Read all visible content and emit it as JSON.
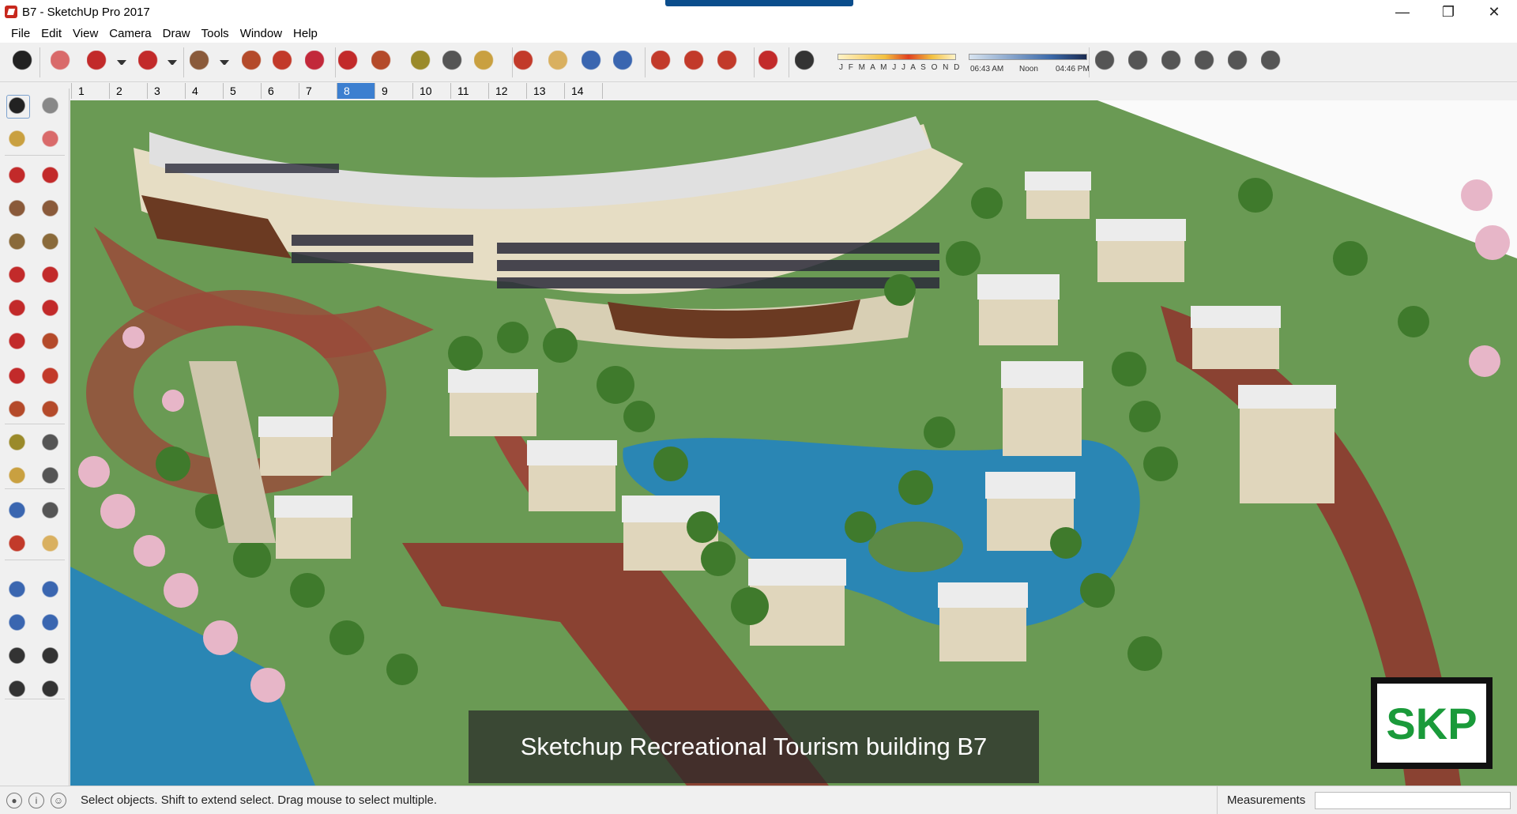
{
  "window": {
    "title": "B7 - SketchUp Pro 2017",
    "controls": {
      "minimize": "—",
      "maximize": "❐",
      "close": "✕"
    }
  },
  "menu": [
    "File",
    "Edit",
    "View",
    "Camera",
    "Draw",
    "Tools",
    "Window",
    "Help"
  ],
  "toolbar": {
    "icons": [
      "select-tool-icon",
      "eraser-icon",
      "pencil-line-icon",
      "dropdown-icon",
      "arc-icon",
      "dropdown-icon",
      "rectangle-icon",
      "dropdown-icon",
      "push-pull-icon",
      "follow-me-icon",
      "move-icon",
      "rotate-icon",
      "scale-icon",
      "tape-measure-icon",
      "text-icon",
      "paint-bucket-icon",
      "orbit-icon",
      "pan-icon",
      "zoom-icon",
      "zoom-extents-icon",
      "3d-warehouse-icon",
      "extension-warehouse-icon",
      "layout-send-icon",
      "ruby-icon",
      "shadow-toggle-icon",
      "iso-view-icon",
      "top-view-icon",
      "front-view-icon",
      "right-view-icon",
      "back-view-icon",
      "left-view-icon"
    ],
    "shadow": {
      "months": "J F M A M J J A S O N D",
      "time_start": "06:43 AM",
      "time_mid": "Noon",
      "time_end": "04:46 PM"
    }
  },
  "scenes": {
    "tabs": [
      "1",
      "2",
      "3",
      "4",
      "5",
      "6",
      "7",
      "8",
      "9",
      "10",
      "11",
      "12",
      "13",
      "14"
    ],
    "active_index": 7
  },
  "left_palette": {
    "icons": [
      "select-icon",
      "make-component-icon",
      "paint-bucket-icon",
      "eraser-icon",
      "line-icon",
      "freehand-icon",
      "rectangle-icon",
      "rotated-rectangle-icon",
      "circle-icon",
      "polygon-icon",
      "arc-icon",
      "two-point-arc-icon",
      "pie-icon",
      "three-point-arc-icon",
      "move-icon",
      "push-pull-icon",
      "rotate-icon",
      "follow-me-icon",
      "scale-icon",
      "offset-icon",
      "tape-measure-icon",
      "dimension-icon",
      "protractor-icon",
      "text-icon",
      "axes-icon",
      "3d-text-icon",
      "orbit-icon",
      "pan-icon",
      "zoom-icon",
      "zoom-window-icon",
      "zoom-extents-icon",
      "previous-view-icon",
      "position-camera-icon",
      "look-around-icon",
      "walk-icon",
      "section-plane-icon"
    ]
  },
  "viewport": {
    "caption": "Sketchup Recreational Tourism building B7",
    "badge": "SKP"
  },
  "status": {
    "message": "Select objects. Shift to extend select. Drag mouse to select multiple.",
    "measurements_label": "Measurements",
    "measurements_value": ""
  },
  "colors": {
    "grass": "#6a9a54",
    "water": "#2a86b4",
    "path": "#9a4a3a",
    "building": "#e6ddc4",
    "roof": "#e8e8e8",
    "accent": "#3c7fd0",
    "badge_text": "#1a9a3a"
  }
}
